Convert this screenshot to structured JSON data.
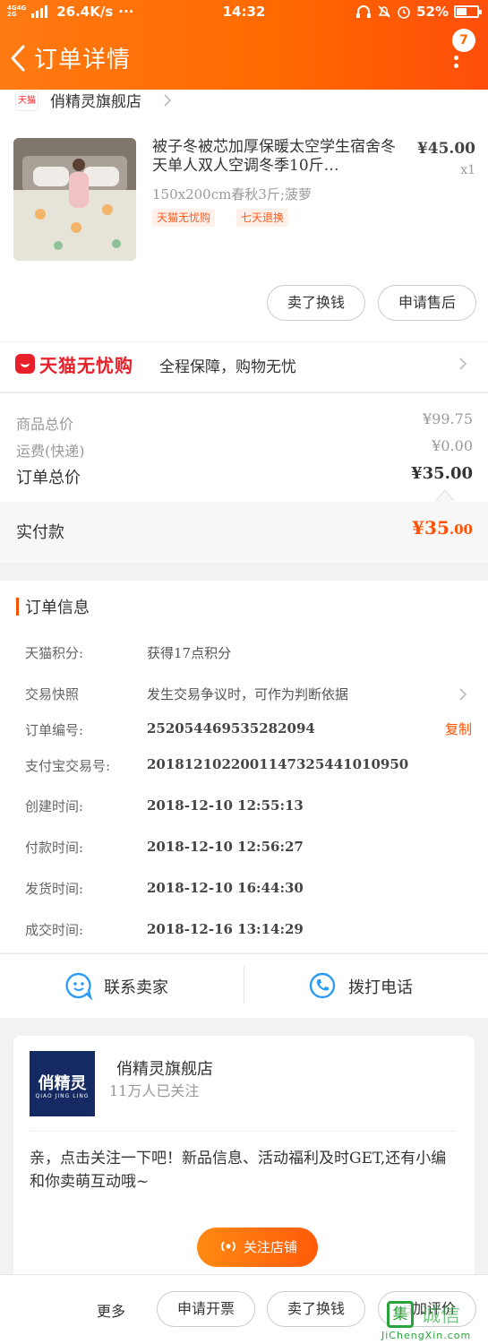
{
  "status_bar": {
    "network_top": "4G4G",
    "network_bottom": "2G",
    "speed": "26.4K/s",
    "more": "···",
    "time": "14:32",
    "battery": "52%",
    "battery_level": 0.52
  },
  "header": {
    "title": "订单详情",
    "badge_count": "7"
  },
  "shop": {
    "badge": "天猫",
    "name": "俏精灵旗舰店"
  },
  "product": {
    "title": "被子冬被芯加厚保暖太空学生宿舍冬天单人双人空调冬季10斤…",
    "sku": "150x200cm春秋3斤;菠萝",
    "tags": [
      "天猫无忧购",
      "七天退换"
    ],
    "price": "¥45.00",
    "qty": "x1"
  },
  "actions": {
    "sell_swap": "卖了换钱",
    "after_sales": "申请售后"
  },
  "guarantee": {
    "brand": "天猫无忧购",
    "text": "全程保障，购物无忧"
  },
  "summary": {
    "goods_label": "商品总价",
    "goods_value": "¥99.75",
    "shipping_label": "运费(快递)",
    "shipping_value": "¥0.00",
    "total_label": "订单总价",
    "total_value": "¥35.00",
    "paid_label": "实付款",
    "paid_value_main": "¥35",
    "paid_value_cents": ".00"
  },
  "order_info": {
    "title": "订单信息",
    "rows": [
      {
        "label": "天猫积分:",
        "value": "获得17点积分"
      },
      {
        "label": "交易快照",
        "value": "发生交易争议时，可作为判断依据"
      },
      {
        "label": "订单编号:",
        "value": "252054469535282094"
      },
      {
        "label": "支付宝交易号:",
        "value": "2018121022001147325441010950"
      },
      {
        "label": "创建时间:",
        "value": "2018-12-10 12:55:13"
      },
      {
        "label": "付款时间:",
        "value": "2018-12-10 12:56:27"
      },
      {
        "label": "发货时间:",
        "value": "2018-12-10 16:44:30"
      },
      {
        "label": "成交时间:",
        "value": "2018-12-16 13:14:29"
      }
    ],
    "copy": "复制"
  },
  "contact": {
    "seller": "联系卖家",
    "call": "拨打电话"
  },
  "follow": {
    "logo_cn": "俏精灵",
    "logo_en": "QIAO JING LING",
    "name": "俏精灵旗舰店",
    "count": "11万人已关注",
    "message": "亲，点击关注一下吧！新品信息、活动福利及时GET,还有小编和你卖萌互动哦~",
    "button": "关注店铺"
  },
  "bottom": {
    "more": "更多",
    "invoice": "申请开票",
    "sell_swap": "卖了换钱",
    "review": "追加评价"
  },
  "watermark": {
    "char": "集",
    "text": "诚信",
    "url": "JiChengXin.com"
  }
}
